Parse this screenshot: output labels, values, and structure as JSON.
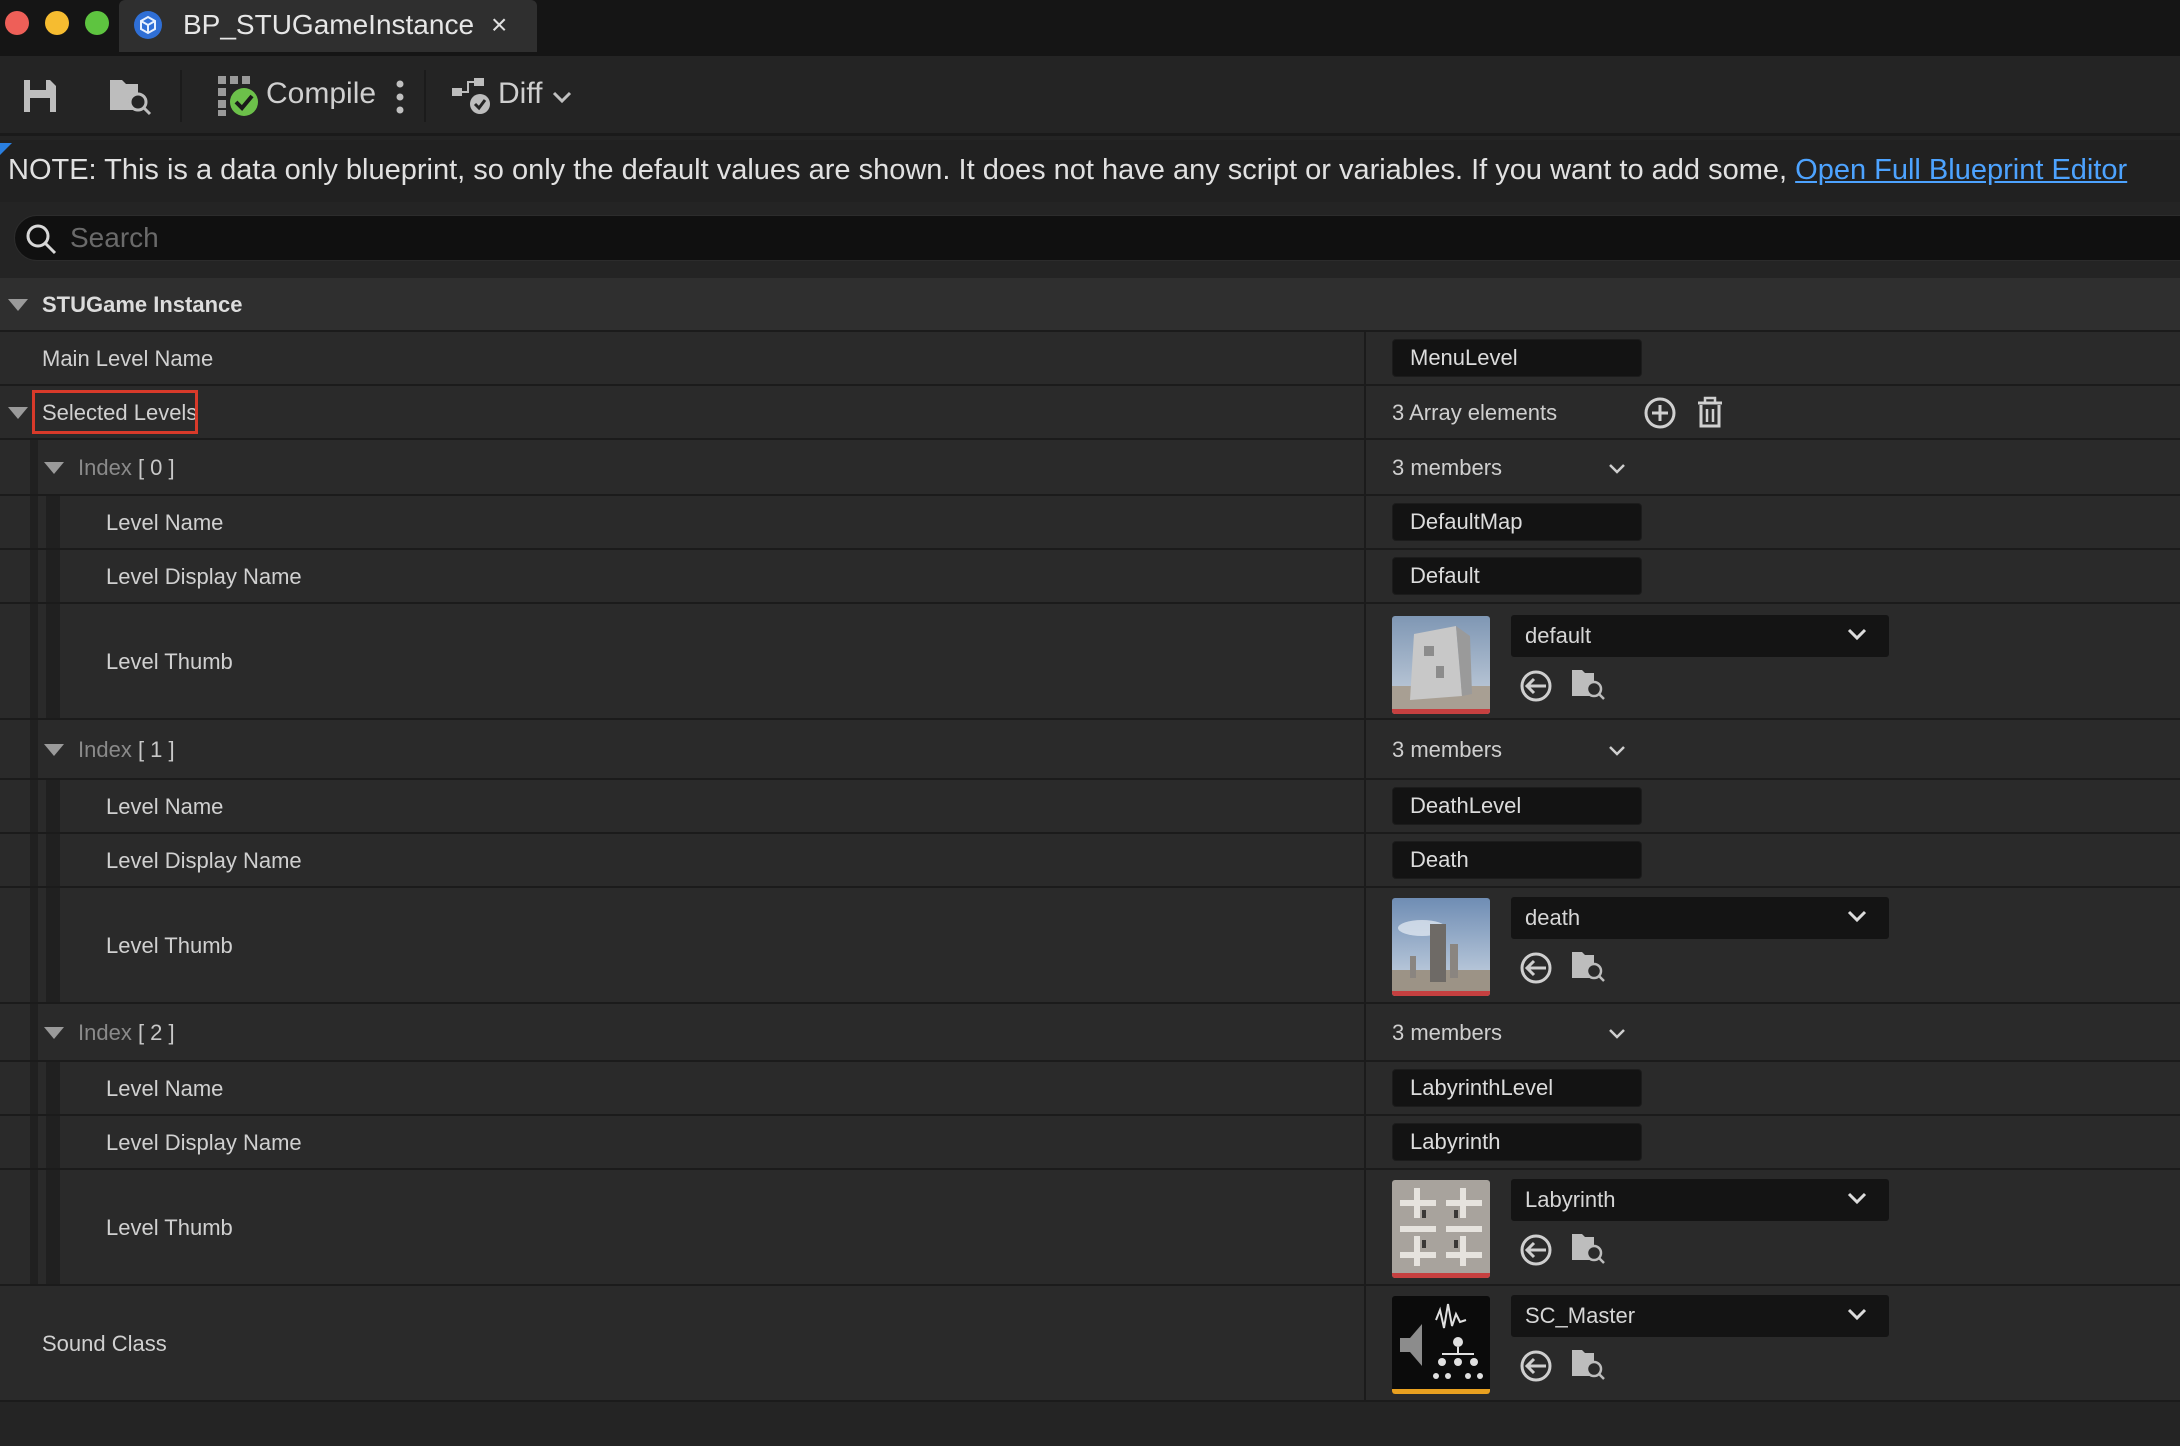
{
  "window": {
    "tab_title": "BP_STUGameInstance",
    "tab_close": "×"
  },
  "toolbar": {
    "compile_label": "Compile",
    "diff_label": "Diff"
  },
  "note": {
    "text": "NOTE: This is a data only blueprint, so only the default values are shown.  It does not have any script or variables.  If you want to add some, ",
    "link": "Open Full Blueprint Editor"
  },
  "search": {
    "placeholder": "Search"
  },
  "category": {
    "name": "STUGame Instance"
  },
  "main_level": {
    "label": "Main Level Name",
    "value": "MenuLevel"
  },
  "selected_levels": {
    "label": "Selected Levels",
    "count": "3 Array elements",
    "items": [
      {
        "index_label": "Index",
        "index_value": "[ 0 ]",
        "members": "3 members",
        "level_name_label": "Level Name",
        "level_name": "DefaultMap",
        "display_name_label": "Level Display Name",
        "display_name": "Default",
        "thumb_label": "Level Thumb",
        "thumb_asset": "default"
      },
      {
        "index_label": "Index",
        "index_value": "[ 1 ]",
        "members": "3 members",
        "level_name_label": "Level Name",
        "level_name": "DeathLevel",
        "display_name_label": "Level Display Name",
        "display_name": "Death",
        "thumb_label": "Level Thumb",
        "thumb_asset": "death"
      },
      {
        "index_label": "Index",
        "index_value": "[ 2 ]",
        "members": "3 members",
        "level_name_label": "Level Name",
        "level_name": "LabyrinthLevel",
        "display_name_label": "Level Display Name",
        "display_name": "Labyrinth",
        "thumb_label": "Level Thumb",
        "thumb_asset": "Labyrinth"
      }
    ]
  },
  "sound_class": {
    "label": "Sound Class",
    "asset": "SC_Master"
  },
  "colors": {
    "accent_link": "#4da3ff",
    "highlight_box": "#d83a2a",
    "compile_ok": "#6cc04a"
  }
}
